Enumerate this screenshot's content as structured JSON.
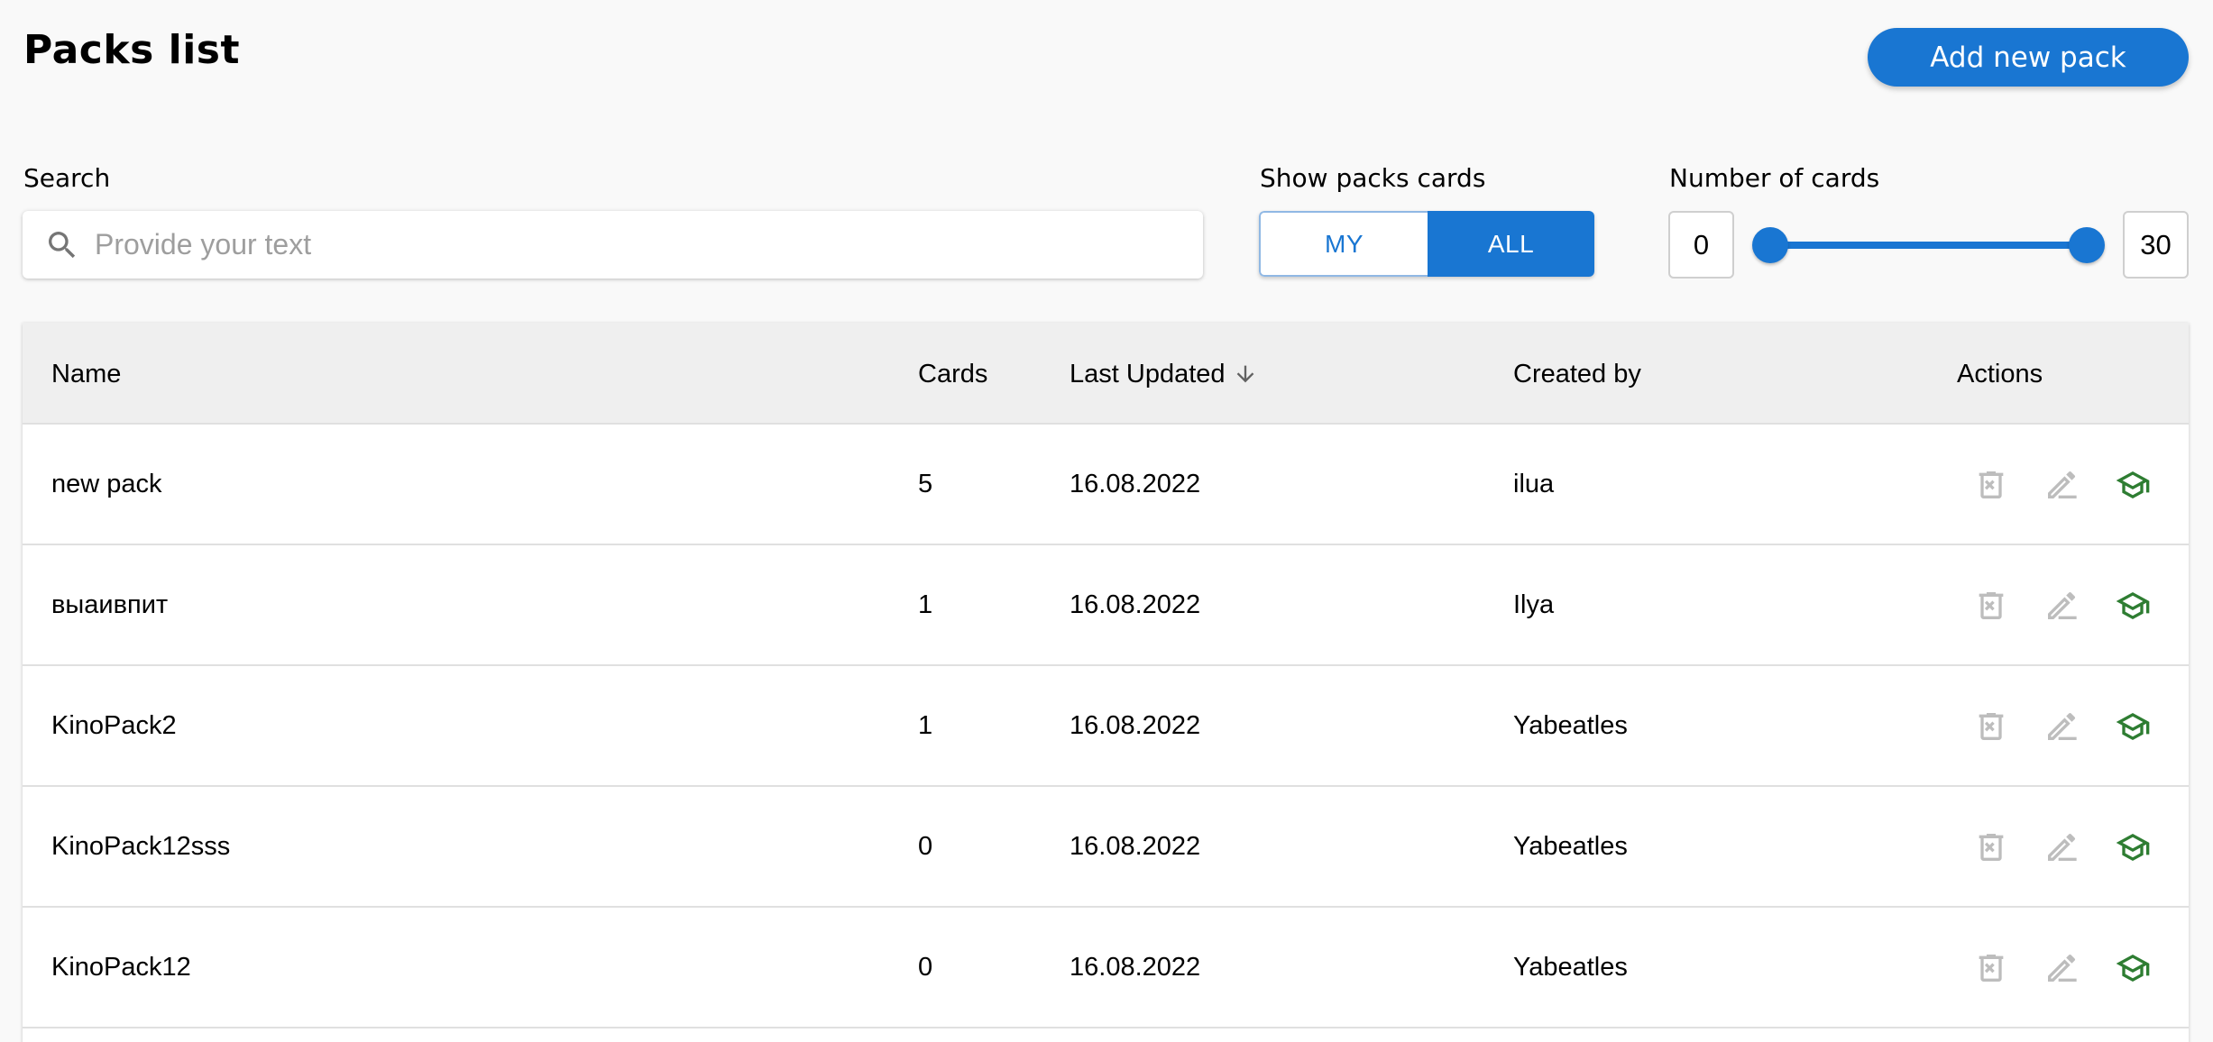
{
  "header": {
    "title": "Packs list",
    "add_button": "Add new pack"
  },
  "filters": {
    "search_label": "Search",
    "search_placeholder": "Provide your text",
    "search_value": "",
    "show_label": "Show packs cards",
    "toggle_my": "MY",
    "toggle_all": "ALL",
    "toggle_selected": "ALL",
    "number_label": "Number of cards",
    "min_value": "0",
    "max_value": "30"
  },
  "table": {
    "columns": {
      "name": "Name",
      "cards": "Cards",
      "updated": "Last Updated",
      "created": "Created by",
      "actions": "Actions"
    },
    "sort_column": "Last Updated",
    "sort_direction": "descending",
    "rows": [
      {
        "name": "new pack",
        "cards": "5",
        "updated": "16.08.2022",
        "created": "ilua"
      },
      {
        "name": "выаивпит",
        "cards": "1",
        "updated": "16.08.2022",
        "created": "Ilya"
      },
      {
        "name": "KinoPack2",
        "cards": "1",
        "updated": "16.08.2022",
        "created": "Yabeatles"
      },
      {
        "name": "KinoPack12sss",
        "cards": "0",
        "updated": "16.08.2022",
        "created": "Yabeatles"
      },
      {
        "name": "KinoPack12",
        "cards": "0",
        "updated": "16.08.2022",
        "created": "Yabeatles"
      }
    ],
    "action_icons": [
      "delete-icon",
      "edit-icon",
      "learn-icon"
    ]
  },
  "colors": {
    "primary": "#1976d2",
    "learn_icon": "#2e7d32",
    "disabled_icon": "#bdbdbd",
    "header_bg": "#efefef",
    "page_bg": "#f9f9f9"
  }
}
